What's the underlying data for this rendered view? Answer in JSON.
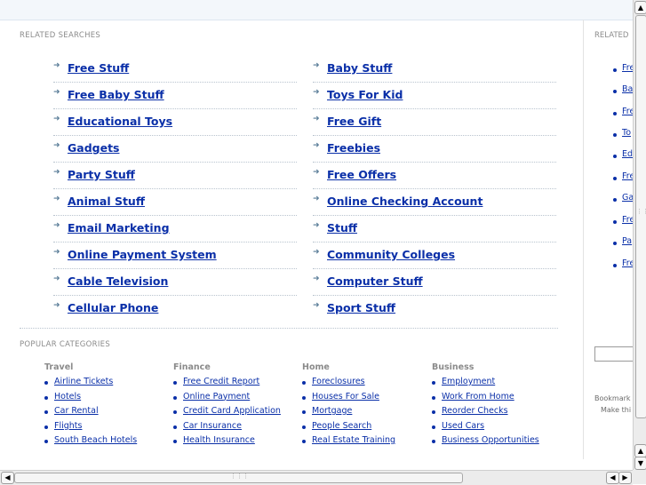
{
  "related_searches": {
    "title": "RELATED SEARCHES",
    "left": [
      "Free Stuff",
      "Free Baby Stuff",
      "Educational Toys",
      "Gadgets",
      "Party Stuff",
      "Animal Stuff",
      "Email Marketing",
      "Online Payment System",
      "Cable Television",
      "Cellular Phone"
    ],
    "right": [
      "Baby Stuff",
      "Toys For Kid",
      "Free Gift",
      "Freebies",
      "Free Offers",
      "Online Checking Account",
      "Stuff",
      "Community Colleges",
      "Computer Stuff",
      "Sport Stuff"
    ]
  },
  "popular_categories": {
    "title": "POPULAR CATEGORIES",
    "columns": [
      {
        "heading": "Travel",
        "items": [
          "Airline Tickets",
          "Hotels",
          "Car Rental",
          "Flights",
          "South Beach Hotels"
        ]
      },
      {
        "heading": "Finance",
        "items": [
          "Free Credit Report",
          "Online Payment",
          "Credit Card Application",
          "Car Insurance",
          "Health Insurance"
        ]
      },
      {
        "heading": "Home",
        "items": [
          "Foreclosures",
          "Houses For Sale",
          "Mortgage",
          "People Search",
          "Real Estate Training"
        ]
      },
      {
        "heading": "Business",
        "items": [
          "Employment",
          "Work From Home",
          "Reorder Checks",
          "Used Cars",
          "Business Opportunities"
        ]
      }
    ]
  },
  "side_panel": {
    "title": "RELATED",
    "items": [
      "Fre",
      "Ba",
      "Fre",
      "To",
      "Ed",
      "Fre",
      "Ga",
      "Fre",
      "Pa",
      "Fre"
    ],
    "bookmark_text": "Bookmark",
    "make_text": "Make thi"
  },
  "scrollbars": {
    "up_arrow": "▲",
    "down_arrow": "▼",
    "left_arrow": "◀",
    "right_arrow": "▶",
    "grip": "⋮⋮⋮"
  }
}
